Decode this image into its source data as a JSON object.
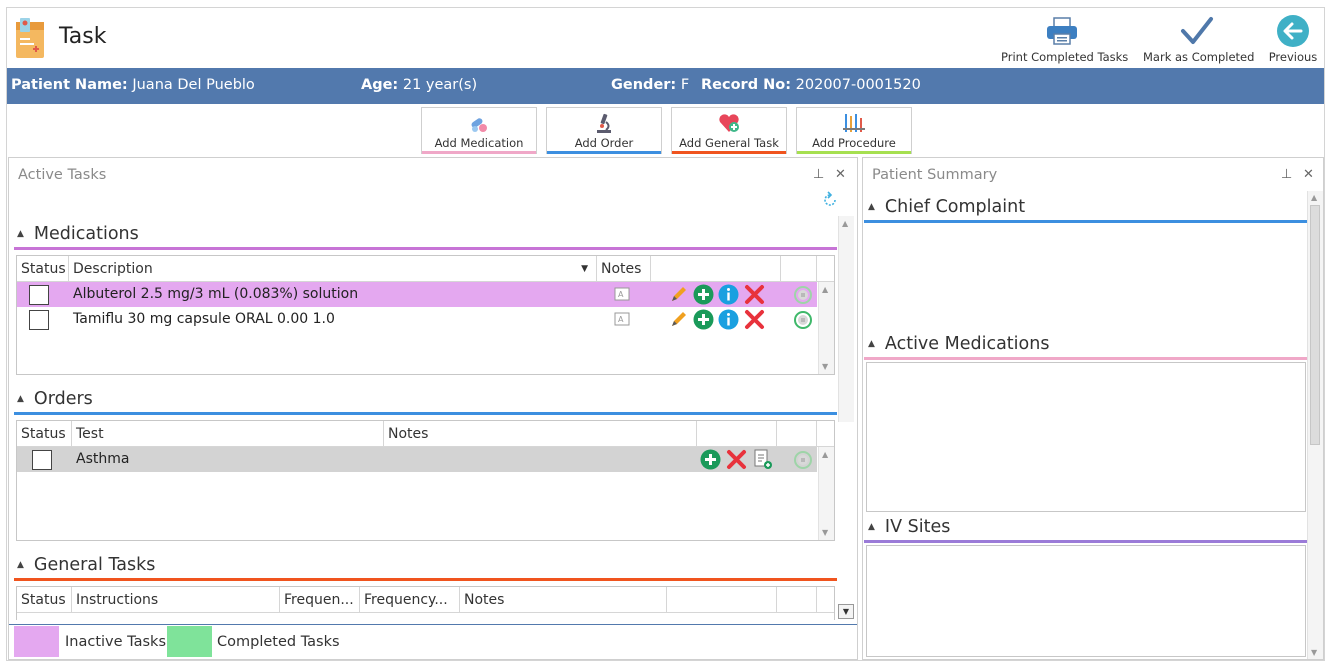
{
  "app": {
    "title": "Task"
  },
  "toolbar": {
    "print_label": "Print Completed Tasks",
    "mark_label": "Mark as Completed",
    "previous_label": "Previous"
  },
  "patient": {
    "name_label": "Patient Name:",
    "name_value": "Juana Del Pueblo",
    "age_label": "Age:",
    "age_value": "21 year(s)",
    "gender_label": "Gender:",
    "gender_value": "F",
    "record_label": "Record No:",
    "record_value": "202007-0001520"
  },
  "add_buttons": {
    "medication": "Add Medication",
    "order": "Add Order",
    "general": "Add General Task",
    "procedure": "Add Procedure"
  },
  "active_tasks": {
    "title": "Active Tasks",
    "medications": {
      "title": "Medications",
      "columns": [
        "Status",
        "Description",
        "Notes"
      ],
      "rows": [
        {
          "description": "Albuterol 2.5 mg/3 mL (0.083%) solution",
          "inactive": true
        },
        {
          "description": "Tamiflu 30 mg capsule ORAL 0.00 1.0",
          "inactive": false
        }
      ]
    },
    "orders": {
      "title": "Orders",
      "columns": [
        "Status",
        "Test",
        "Notes"
      ],
      "rows": [
        {
          "test": "Asthma"
        }
      ]
    },
    "general_tasks": {
      "title": "General Tasks",
      "columns": [
        "Status",
        "Instructions",
        "Frequen...",
        "Frequency...",
        "Notes"
      ]
    }
  },
  "legend": {
    "inactive_label": "Inactive Tasks",
    "completed_label": "Completed Tasks",
    "inactive_color": "#e4a8f0",
    "completed_color": "#7fe39a"
  },
  "patient_summary": {
    "title": "Patient Summary",
    "chief_complaint": "Chief Complaint",
    "active_medications": "Active Medications",
    "iv_sites": "IV Sites"
  },
  "colors": {
    "patient_bar": "#5279ad",
    "medications_accent": "#c774d6",
    "orders_accent": "#3c8fe0",
    "general_accent": "#f0541e",
    "procedure_accent": "#a6e050",
    "medication_btn_accent": "#f0a8c8",
    "inactive_row": "#e4a8f0",
    "selected_row": "#d3d3d3"
  }
}
